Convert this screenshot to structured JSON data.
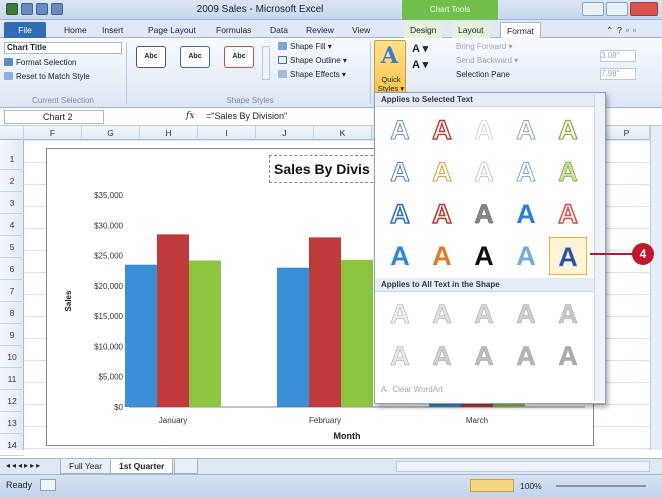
{
  "window": {
    "title": "2009 Sales - Microsoft Excel",
    "context_tab_group": "Chart Tools"
  },
  "tabs": [
    "File",
    "Home",
    "Insert",
    "Page Layout",
    "Formulas",
    "Data",
    "Review",
    "View",
    "Design",
    "Layout",
    "Format"
  ],
  "ribbon": {
    "current_selection": {
      "selector_value": "Chart Title",
      "format_selection": "Format Selection",
      "reset": "Reset to Match Style",
      "label": "Current Selection"
    },
    "shape_styles": {
      "preset_label": "Abc",
      "shape_fill": "Shape Fill",
      "shape_outline": "Shape Outline",
      "shape_effects": "Shape Effects",
      "label": "Shape Styles"
    },
    "wordart": {
      "quick_styles_line1": "Quick",
      "quick_styles_line2": "Styles"
    },
    "arrange": {
      "bring_forward": "Bring Forward",
      "send_backward": "Send Backward",
      "selection_pane": "Selection Pane"
    },
    "size": {
      "height": "3.08\"",
      "width": "7.98\""
    }
  },
  "formula_bar": {
    "name_box": "Chart 2",
    "fx": "fx",
    "formula": "=\"Sales By Division\""
  },
  "columns": [
    "F",
    "G",
    "H",
    "I",
    "J",
    "K",
    "L",
    "M",
    "N",
    "O",
    "P"
  ],
  "rows": [
    "1",
    "2",
    "3",
    "4",
    "5",
    "6",
    "7",
    "8",
    "9",
    "10",
    "11",
    "12",
    "13",
    "14"
  ],
  "chart": {
    "title_visible": "Sales By Divis"
  },
  "chart_data": {
    "type": "bar",
    "title": "Sales By Division",
    "xlabel": "Month",
    "ylabel": "Sales",
    "categories": [
      "January",
      "February",
      "March"
    ],
    "series": [
      {
        "values": [
          23500,
          23000,
          22500
        ],
        "color": "#3a8fd8"
      },
      {
        "values": [
          28500,
          28000,
          27500
        ],
        "color": "#c0393b"
      },
      {
        "values": [
          24200,
          24300,
          24000
        ],
        "color": "#8cc63f"
      }
    ],
    "ylim": [
      0,
      35000
    ],
    "ticks": [
      "$35,000",
      "$30,000",
      "$25,000",
      "$20,000",
      "$15,000",
      "$10,000",
      "$5,000",
      "$0"
    ],
    "grid": false,
    "legend_partial": [
      "st",
      "th"
    ]
  },
  "gallery": {
    "section1": "Applies to Selected Text",
    "section2": "Applies to All Text in the Shape",
    "clear": "Clear WordArt",
    "glyph": "A"
  },
  "callout": {
    "text": "4"
  },
  "sheets": {
    "tabs": [
      "Full Year",
      "1st Quarter"
    ]
  },
  "status": {
    "ready": "Ready",
    "zoom": "100%"
  }
}
